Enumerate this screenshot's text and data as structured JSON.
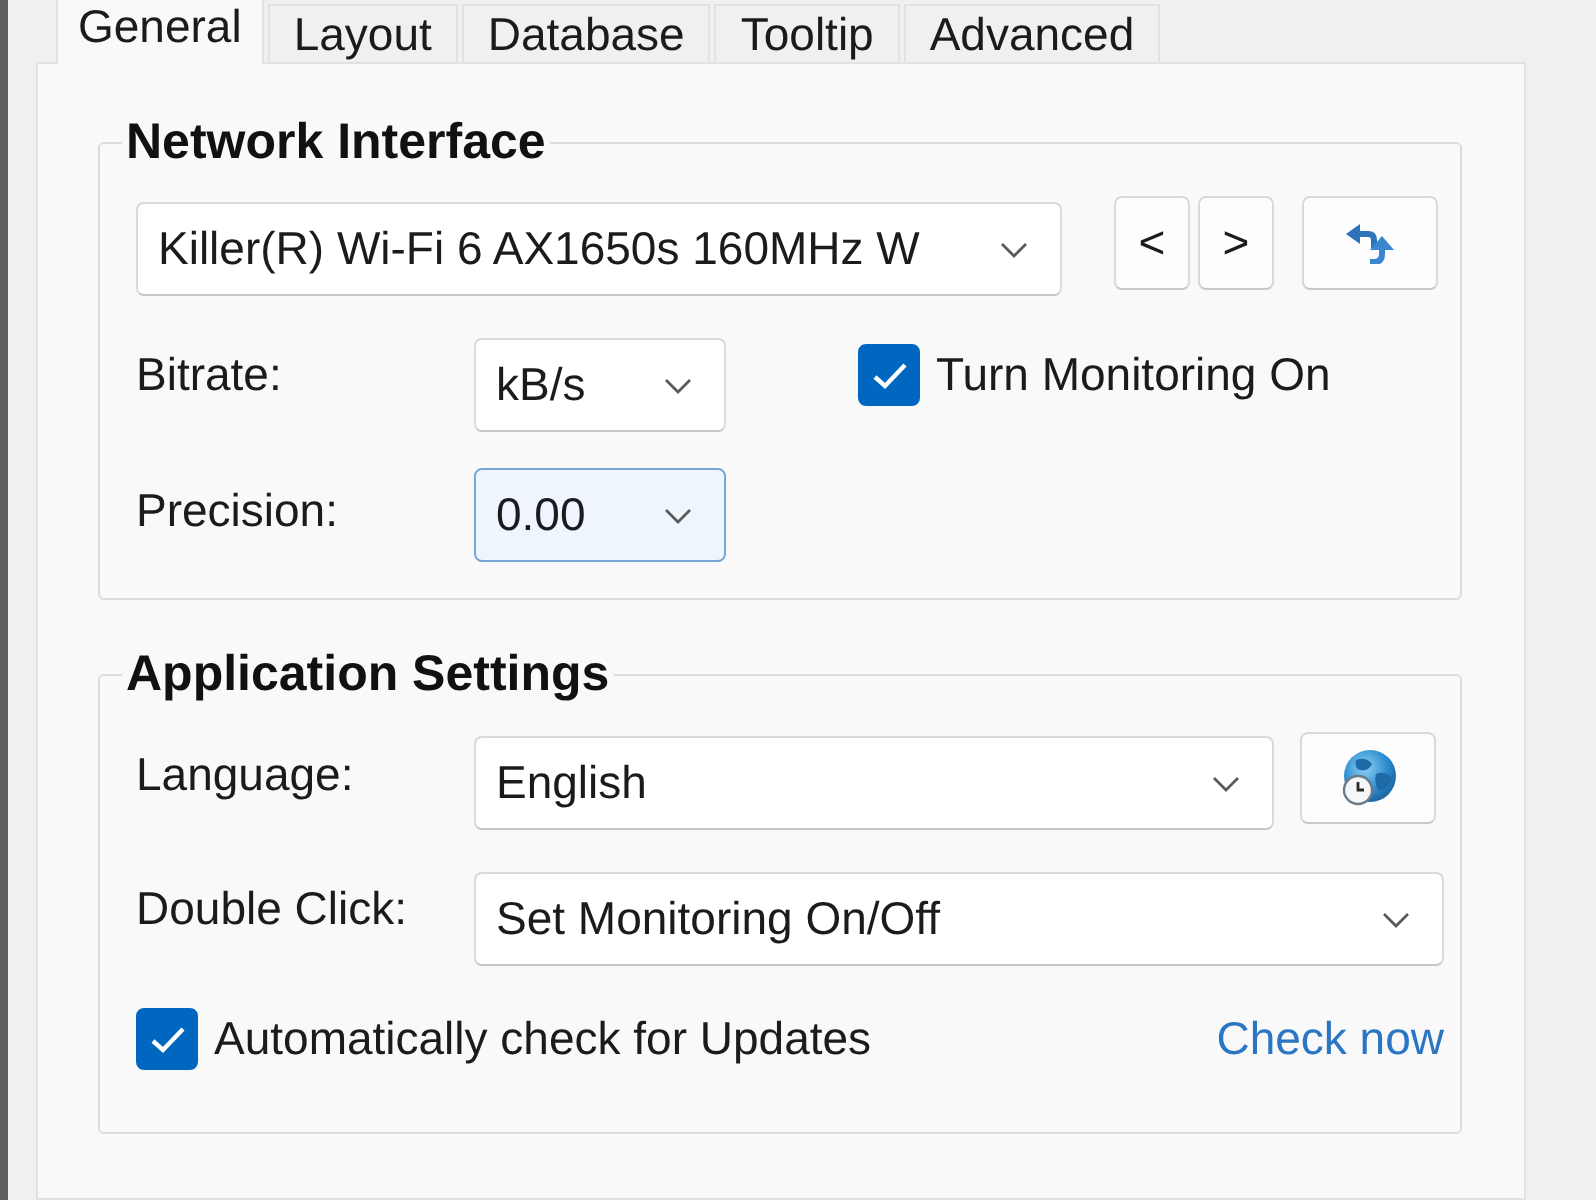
{
  "tabs": [
    {
      "label": "General",
      "selected": true
    },
    {
      "label": "Layout",
      "selected": false
    },
    {
      "label": "Database",
      "selected": false
    },
    {
      "label": "Tooltip",
      "selected": false
    },
    {
      "label": "Advanced",
      "selected": false
    }
  ],
  "network_interface": {
    "title": "Network Interface",
    "adapter": {
      "value": "Killer(R) Wi-Fi 6 AX1650s 160MHz W",
      "focused": false
    },
    "prev_button": "<",
    "next_button": ">",
    "bitrate": {
      "label": "Bitrate:",
      "value": "kB/s",
      "focused": false
    },
    "monitoring": {
      "label": "Turn Monitoring On",
      "checked": true
    },
    "precision": {
      "label": "Precision:",
      "value": "0.00",
      "focused": true
    }
  },
  "application_settings": {
    "title": "Application Settings",
    "language": {
      "label": "Language:",
      "value": "English",
      "focused": false
    },
    "double_click": {
      "label": "Double Click:",
      "value": "Set Monitoring On/Off",
      "focused": false
    },
    "auto_update": {
      "label": "Automatically check for Updates",
      "checked": true
    },
    "check_now_link": "Check now"
  }
}
